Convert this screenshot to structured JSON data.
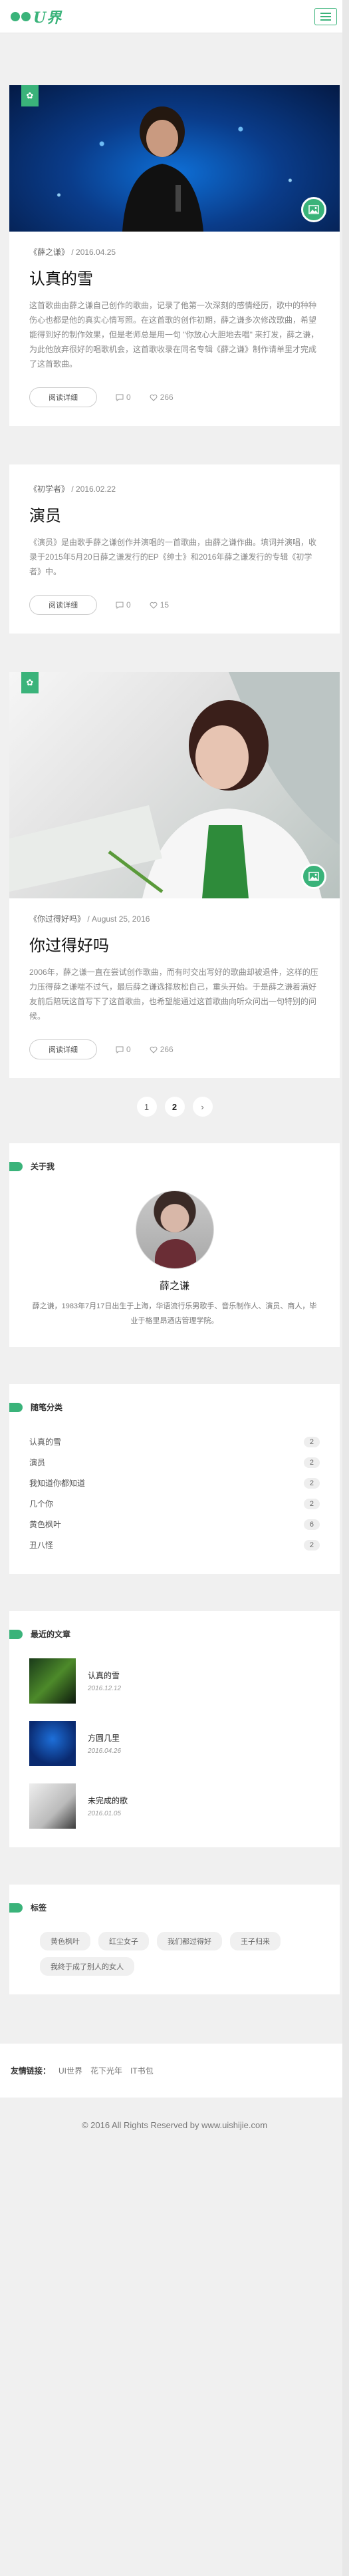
{
  "header": {
    "logo_text": "U界"
  },
  "posts": [
    {
      "category": "《薛之谦》",
      "date": "/ 2016.04.25",
      "title": "认真的雪",
      "excerpt": "这首歌曲由薛之谦自己创作的歌曲，记录了他第一次深刻的感情经历，歌中的种种伤心也都是他的真实心情写照。在这首歌的创作初期，薛之谦多次修改歌曲，希望能得到好的制作效果，但是老师总是用一句 \"你放心大胆地去唱\" 来打发，薛之谦，为此他放弃很好的唱歌机会，这首歌收录在同名专辑《薛之谦》制作请单里才完成了这首歌曲。",
      "read_label": "阅读详细",
      "comments": "0",
      "likes": "266"
    },
    {
      "category": "《初学者》",
      "date": "/ 2016.02.22",
      "title": "演员",
      "excerpt": "《演员》是由歌手薛之谦创作并演唱的一首歌曲，由薛之谦作曲。填词并演唱，收录于2015年5月20日薛之谦发行的EP《绅士》和2016年薛之谦发行的专辑《初学者》中。",
      "read_label": "阅读详细",
      "comments": "0",
      "likes": "15"
    },
    {
      "category": "《你过得好吗》",
      "date": "/ August 25, 2016",
      "title": "你过得好吗",
      "excerpt": "2006年，薛之谦一直在尝试创作歌曲，而有时交出写好的歌曲却被退件，这样的压力压得薛之谦喘不过气，最后薛之谦选择放松自己，重头开始。于是薛之谦着满好友前后陪玩这首写下了这首歌曲，也希望能通过这首歌曲向听众问出一句特别的问候。",
      "read_label": "阅读详细",
      "comments": "0",
      "likes": "266"
    }
  ],
  "pagination": {
    "prev": "1",
    "current": "2",
    "next": "›"
  },
  "about": {
    "title": "关于我",
    "name": "薛之谦",
    "desc": "薛之谦，1983年7月17日出生于上海，华语流行乐男歌手、音乐制作人、演员、商人，毕业于格里昂酒店管理学院。"
  },
  "categories": {
    "title": "随笔分类",
    "items": [
      {
        "label": "认真的雪",
        "count": "2"
      },
      {
        "label": "演员",
        "count": "2"
      },
      {
        "label": "我知道你都知道",
        "count": "2"
      },
      {
        "label": "几个你",
        "count": "2"
      },
      {
        "label": "黄色枫叶",
        "count": "6"
      },
      {
        "label": "丑八怪",
        "count": "2"
      }
    ]
  },
  "recent": {
    "title": "最近的文章",
    "items": [
      {
        "title": "认真的雪",
        "date": "2016.12.12"
      },
      {
        "title": "方圆几里",
        "date": "2016.04.26"
      },
      {
        "title": "未完成的歌",
        "date": "2016.01.05"
      }
    ]
  },
  "tags": {
    "title": "标签",
    "items": [
      "黄色枫叶",
      "红尘女子",
      "我们都过得好",
      "王子归来",
      "我终于成了别人的女人"
    ]
  },
  "footer": {
    "links_label": "友情链接：",
    "links": [
      "UI世界",
      "花下光年",
      "IT书包"
    ],
    "copyright": "© 2016 All Rights Reserved by www.uishijie.com"
  },
  "colors": {
    "accent": "#3ab37a",
    "background": "#f0f0f0"
  }
}
